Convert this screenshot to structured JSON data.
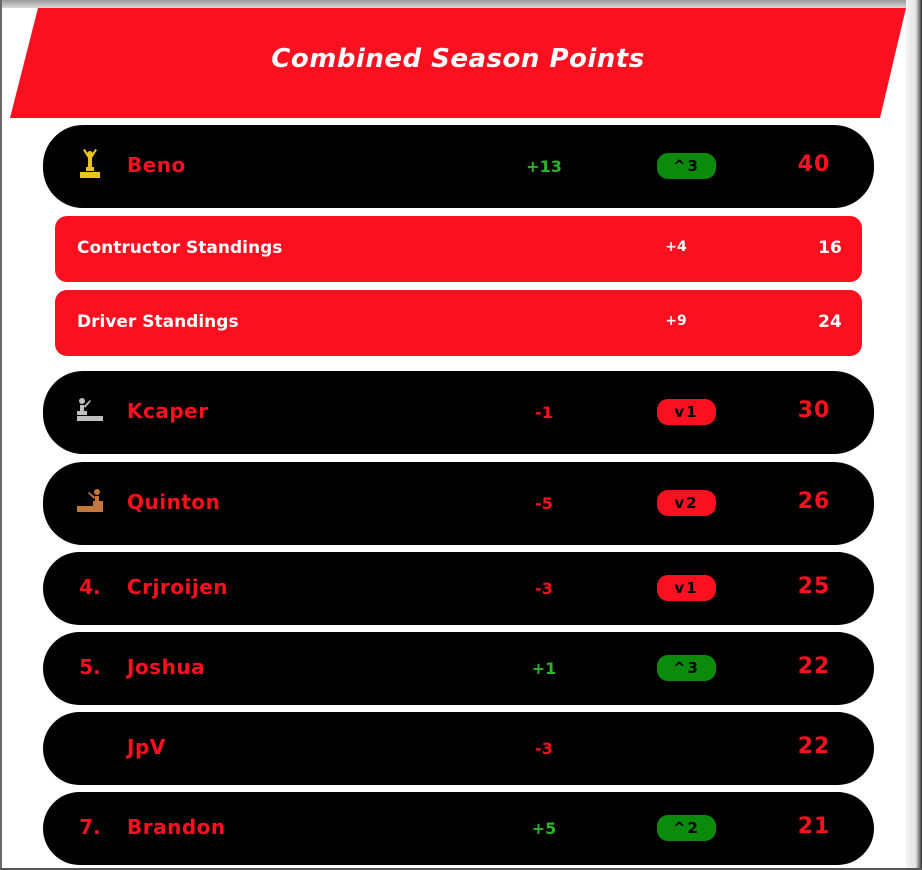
{
  "header": {
    "title": "Combined Season Points"
  },
  "colors": {
    "accent": "#fb101f",
    "gold": "#e9c51f",
    "silver": "#bfbfbf",
    "bronze": "#c2773d",
    "positive": "#2bb52b",
    "up_badge": "#0b8a0b"
  },
  "leader": {
    "icon": "gold-podium-icon",
    "name": "Beno",
    "diff": "+13",
    "move": "^3",
    "points": "40",
    "breakdown": [
      {
        "label": "Contructor Standings",
        "diff": "+4",
        "points": "16"
      },
      {
        "label": "Driver Standings",
        "diff": "+9",
        "points": "24"
      }
    ]
  },
  "rows": [
    {
      "rank": "",
      "icon": "silver-podium-icon",
      "name": "Kcaper",
      "diff": "-1",
      "move": "v1",
      "points": "30"
    },
    {
      "rank": "",
      "icon": "bronze-podium-icon",
      "name": "Quinton",
      "diff": "-5",
      "move": "v2",
      "points": "26"
    },
    {
      "rank": "4.",
      "icon": "",
      "name": "Crjroijen",
      "diff": "-3",
      "move": "v1",
      "points": "25"
    },
    {
      "rank": "5.",
      "icon": "",
      "name": "Joshua",
      "diff": "+1",
      "move": "^3",
      "points": "22"
    },
    {
      "rank": "",
      "icon": "",
      "name": "JpV",
      "diff": "-3",
      "move": "",
      "points": "22"
    },
    {
      "rank": "7.",
      "icon": "",
      "name": "Brandon",
      "diff": "+5",
      "move": "^2",
      "points": "21"
    }
  ]
}
